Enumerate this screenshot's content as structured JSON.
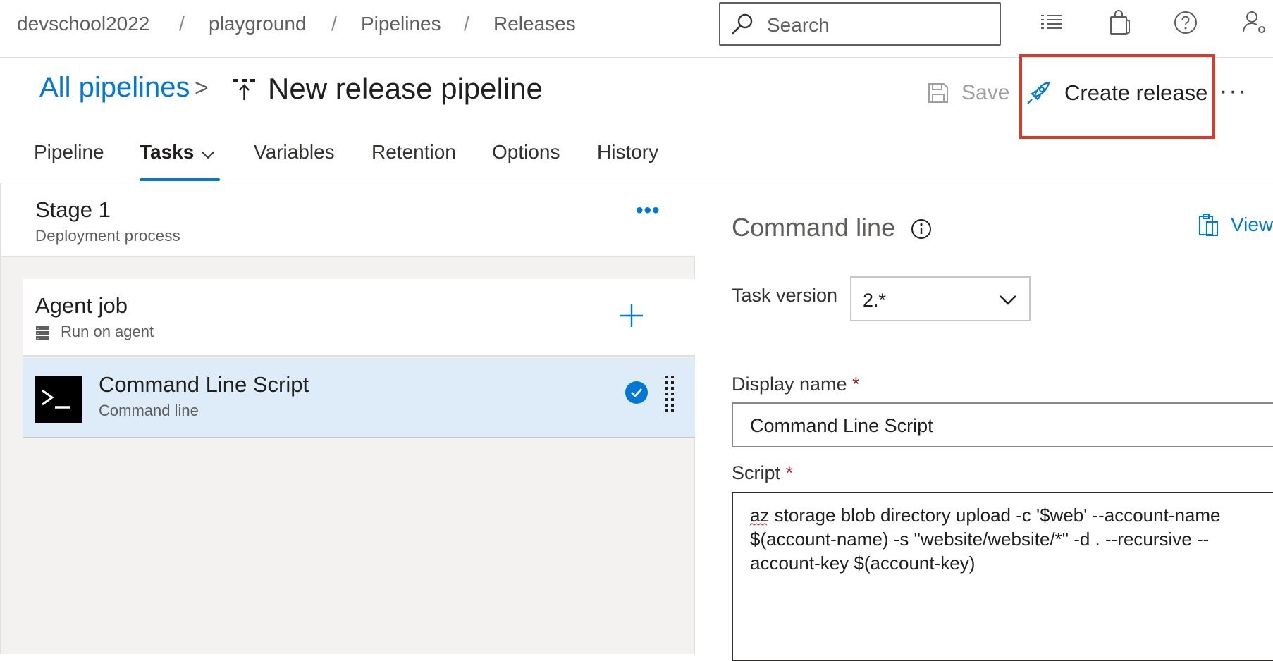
{
  "breadcrumb": {
    "org": "devschool2022",
    "project": "playground",
    "section": "Pipelines",
    "page": "Releases",
    "separator": "/"
  },
  "search": {
    "placeholder": "Search"
  },
  "header": {
    "back_link": "All pipelines",
    "chevron": ">",
    "title": "New release pipeline",
    "save_label": "Save",
    "create_release_label": "Create release",
    "more": "···"
  },
  "tabs": [
    {
      "label": "Pipeline"
    },
    {
      "label": "Tasks"
    },
    {
      "label": "Variables"
    },
    {
      "label": "Retention"
    },
    {
      "label": "Options"
    },
    {
      "label": "History"
    }
  ],
  "stage": {
    "title": "Stage 1",
    "subtitle": "Deployment process",
    "more": "•••"
  },
  "agent_job": {
    "title": "Agent job",
    "subtitle": "Run on agent"
  },
  "task": {
    "title": "Command Line Script",
    "subtitle": "Command line"
  },
  "panel": {
    "title": "Command line",
    "view_label": "View",
    "task_version_label": "Task version",
    "task_version_value": "2.*",
    "display_name_label": "Display name",
    "display_name_value": "Command Line Script",
    "script_label": "Script",
    "required_mark": "*",
    "script_lines": [
      "az storage blob directory upload -c '$web' --account-name",
      "$(account-name) -s \"website/website/*\" -d . --recursive --",
      "account-key $(account-key)"
    ]
  },
  "colors": {
    "accent": "#0078d4",
    "highlight": "#d83b2b",
    "selected_row": "#deecf9",
    "required": "#a4262c"
  },
  "icons": [
    "search-icon",
    "checklist-icon",
    "shopping-bag-icon",
    "help-icon",
    "user-settings-icon",
    "release-pipeline-icon",
    "save-icon",
    "rocket-icon",
    "info-icon",
    "clipboard-icon",
    "server-icon",
    "plus-icon",
    "terminal-icon",
    "check-circle-icon",
    "drag-handle-icon",
    "chevron-down-icon"
  ]
}
